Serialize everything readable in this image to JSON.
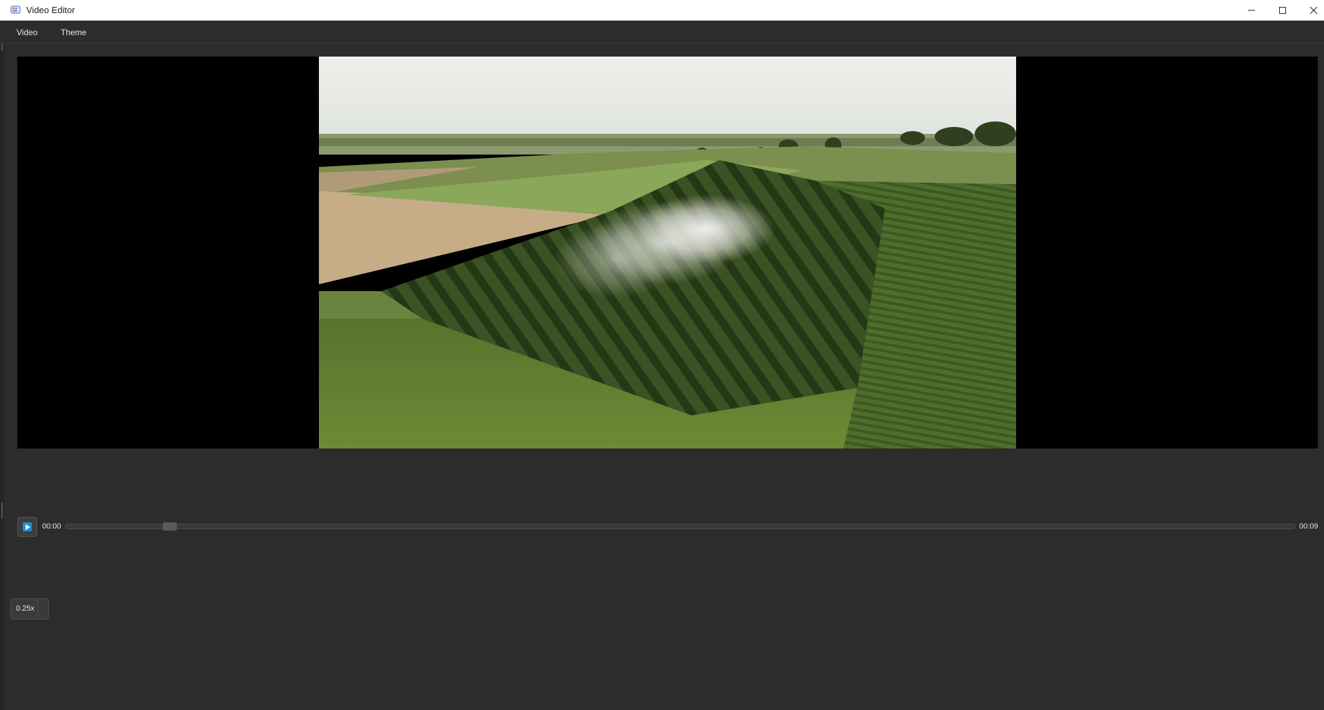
{
  "window": {
    "title": "Video Editor",
    "app_icon": "video-editor-app-icon"
  },
  "menu": {
    "items": [
      {
        "label": "Video"
      },
      {
        "label": "Theme"
      }
    ]
  },
  "player": {
    "current_time": "00:00",
    "total_time": "00:09",
    "seek_position": 0.085,
    "play_icon": "play-icon",
    "accent_color": "#1f8fd6"
  },
  "speed": {
    "value": "0.25x"
  },
  "colors": {
    "background": "#2c2c2c",
    "titlebar": "#ffffff",
    "video_background": "#000000"
  }
}
